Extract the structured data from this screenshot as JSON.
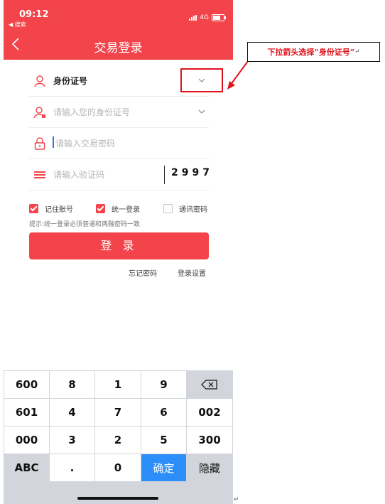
{
  "status_bar": {
    "time": "09:12",
    "back_app": "◀ 搜索",
    "network": "4G"
  },
  "header": {
    "title": "交易登录"
  },
  "form": {
    "id_type": {
      "label": "身份证号"
    },
    "id_number": {
      "placeholder": "请输入您的身份证号"
    },
    "password": {
      "placeholder": "请输入交易密码"
    },
    "captcha": {
      "placeholder": "请输入验证码",
      "code": "2997"
    }
  },
  "options": [
    {
      "label": "记住账号",
      "checked": true
    },
    {
      "label": "统一登录",
      "checked": true
    },
    {
      "label": "通讯密码",
      "checked": false
    }
  ],
  "hint": "提示:统一登录必须普通和两融密码一致",
  "login_button": "登 录",
  "links": {
    "forgot": "忘记密码",
    "settings": "登录设置"
  },
  "keyboard": {
    "rows": [
      [
        "600",
        "8",
        "1",
        "9",
        "⌫"
      ],
      [
        "601",
        "4",
        "7",
        "6",
        "002"
      ],
      [
        "000",
        "3",
        "2",
        "5",
        "300"
      ],
      [
        "ABC",
        ".",
        "0",
        "确定",
        "隐藏"
      ]
    ]
  },
  "annotation": {
    "text": "下拉箭头选择“身份证号”",
    "mark": "↵"
  },
  "colors": {
    "brand_red": "#f2444a",
    "confirm_blue": "#2c8ef8",
    "keyboard_bg": "#d2d5db"
  }
}
